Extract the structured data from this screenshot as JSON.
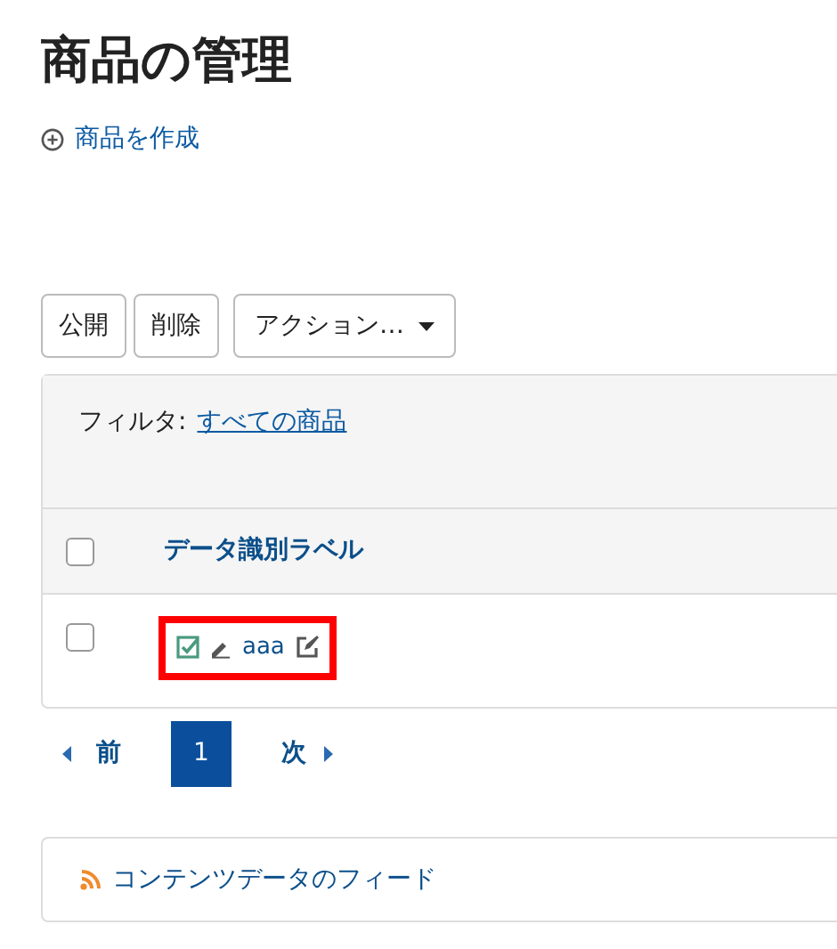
{
  "title": "商品の管理",
  "create_link": "商品を作成",
  "toolbar": {
    "buttons": [
      "公開",
      "削除"
    ],
    "dropdown": "アクション…"
  },
  "filter": {
    "label": "フィルタ:",
    "value": "すべての商品"
  },
  "table": {
    "select_all_checked": false,
    "columns": [
      "データ識別ラベル"
    ],
    "rows": [
      {
        "checked": false,
        "published": true,
        "label": "aaa",
        "highlighted": true
      }
    ]
  },
  "pagination": {
    "prev": "前",
    "next": "次",
    "pages": [
      {
        "label": "1",
        "selected": true
      }
    ]
  },
  "feed": "コンテンツデータのフィード"
}
